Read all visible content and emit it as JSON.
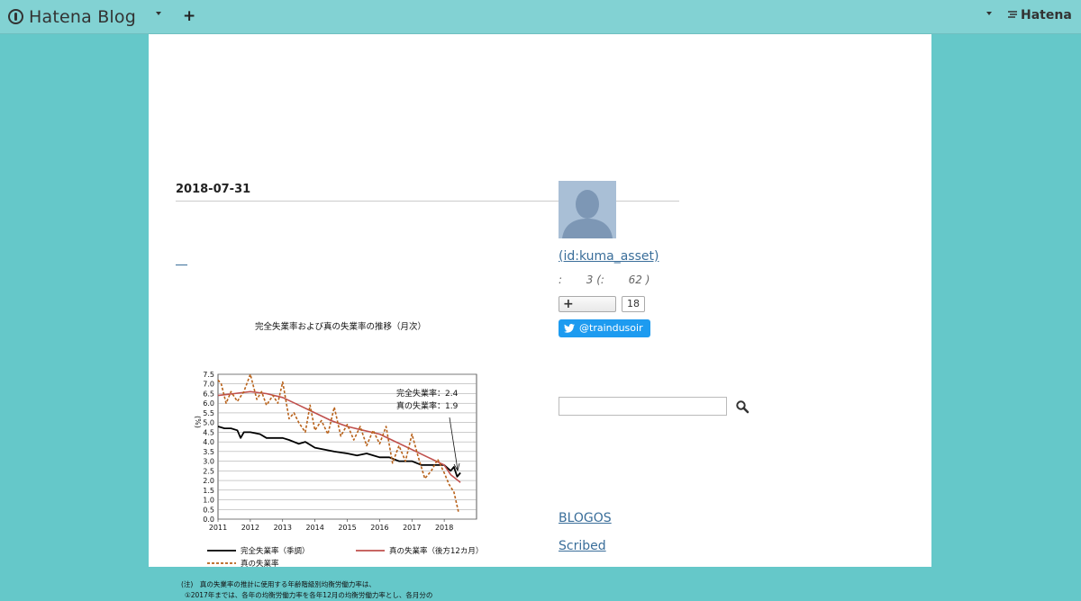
{
  "header": {
    "brand": "Hatena Blog",
    "add_label": "+",
    "right_brand": "Hatena",
    "right_brand_icon": "three-lines-icon"
  },
  "entry": {
    "date": "2018-07-31",
    "link_text": "__"
  },
  "chart_data": {
    "type": "line",
    "title": "完全失業率および真の失業率の推移（月次）",
    "ylabel": "(%)",
    "ylim": [
      0,
      7.5
    ],
    "yticks": [
      "0.0",
      "0.5",
      "1.0",
      "1.5",
      "2.0",
      "2.5",
      "3.0",
      "3.5",
      "4.0",
      "4.5",
      "5.0",
      "5.5",
      "6.0",
      "6.5",
      "7.0",
      "7.5"
    ],
    "xticks": [
      "2011",
      "2012",
      "2013",
      "2014",
      "2015",
      "2016",
      "2017",
      "2018"
    ],
    "xlim": [
      2011.0,
      2019.0
    ],
    "annotation_line1": "完全失業率：2.4",
    "annotation_line2": "真の失業率：1.9",
    "legend": [
      {
        "label": "完全失業率（季調）",
        "color": "#000000",
        "dash": false
      },
      {
        "label": "真の失業率（後方12カ月）",
        "color": "#c0504d",
        "dash": false
      },
      {
        "label": "真の失業率",
        "color": "#b8621b",
        "dash": true
      }
    ],
    "note1": "(注)　真の失業率の推計に使用する年齢階級別均衡労働力率は、",
    "note2": "①2017年までは、各年の均衡労働力率を各年12月の均衡労働力率とし、各月分の",
    "series": [
      {
        "name": "完全失業率（季調）",
        "color": "#000000",
        "x": [
          2011.0,
          2011.2,
          2011.4,
          2011.6,
          2011.7,
          2011.8,
          2012.0,
          2012.3,
          2012.5,
          2012.7,
          2013.0,
          2013.2,
          2013.5,
          2013.7,
          2014.0,
          2014.3,
          2014.6,
          2015.0,
          2015.3,
          2015.6,
          2016.0,
          2016.3,
          2016.6,
          2017.0,
          2017.3,
          2017.6,
          2018.0,
          2018.2,
          2018.3,
          2018.4,
          2018.5
        ],
        "y": [
          4.8,
          4.7,
          4.7,
          4.6,
          4.2,
          4.5,
          4.5,
          4.4,
          4.2,
          4.2,
          4.2,
          4.1,
          3.9,
          4.0,
          3.7,
          3.6,
          3.5,
          3.4,
          3.3,
          3.4,
          3.2,
          3.2,
          3.0,
          3.0,
          2.8,
          2.8,
          2.8,
          2.5,
          2.7,
          2.2,
          2.4
        ]
      },
      {
        "name": "真の失業率（後方12カ月）",
        "color": "#c0504d",
        "x": [
          2011.0,
          2011.5,
          2012.0,
          2012.5,
          2013.0,
          2013.5,
          2014.0,
          2014.5,
          2015.0,
          2015.5,
          2016.0,
          2016.5,
          2017.0,
          2017.5,
          2018.0,
          2018.2,
          2018.5
        ],
        "y": [
          6.4,
          6.5,
          6.6,
          6.5,
          6.3,
          5.9,
          5.5,
          5.1,
          4.8,
          4.6,
          4.4,
          4.0,
          3.6,
          3.2,
          2.8,
          2.3,
          1.9
        ]
      },
      {
        "name": "真の失業率",
        "color": "#b8621b",
        "dash": true,
        "x": [
          2011.0,
          2011.1,
          2011.25,
          2011.4,
          2011.6,
          2011.8,
          2012.0,
          2012.2,
          2012.35,
          2012.5,
          2012.7,
          2012.85,
          2013.0,
          2013.2,
          2013.35,
          2013.5,
          2013.7,
          2013.85,
          2014.0,
          2014.2,
          2014.4,
          2014.6,
          2014.8,
          2015.0,
          2015.2,
          2015.4,
          2015.6,
          2015.8,
          2016.0,
          2016.2,
          2016.4,
          2016.6,
          2016.8,
          2017.0,
          2017.2,
          2017.4,
          2017.6,
          2017.8,
          2018.0,
          2018.15,
          2018.3,
          2018.45
        ],
        "y": [
          7.2,
          7.0,
          6.0,
          6.6,
          6.1,
          6.6,
          7.5,
          6.2,
          6.6,
          5.9,
          6.4,
          6.0,
          7.1,
          5.2,
          5.5,
          5.0,
          4.5,
          5.9,
          4.6,
          5.1,
          4.4,
          5.8,
          4.3,
          4.9,
          4.1,
          4.8,
          3.8,
          4.6,
          3.9,
          4.8,
          2.9,
          3.8,
          3.0,
          4.4,
          3.2,
          2.1,
          2.5,
          3.1,
          2.4,
          1.8,
          1.4,
          0.3
        ]
      }
    ]
  },
  "sidebar": {
    "profile_name": " (id:kuma_asset)",
    "profile_meta": ":       3 (:       62 )",
    "follow_label": "+",
    "follow_count": "18",
    "twitter_label": "@traindusoir",
    "search_placeholder": "",
    "links": [
      "BLOGOS",
      "Scribed"
    ]
  }
}
